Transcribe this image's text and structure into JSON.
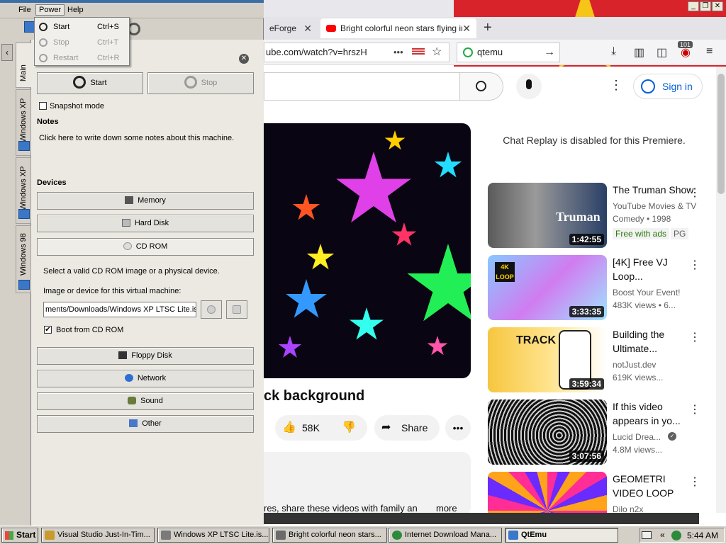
{
  "browser": {
    "window_controls": {
      "minimize": "_",
      "maximize": "❐",
      "close": "✕"
    },
    "tabs": [
      {
        "label": "eForge",
        "close": "✕"
      },
      {
        "label": "Bright colorful neon stars flying in",
        "close": "✕"
      }
    ],
    "new_tab": "+",
    "url_text": "ube.com/watch?v=hrszH",
    "url_more": "•••",
    "search_value": "qtemu",
    "search_go": "→",
    "badge_count": "101",
    "nav_icons": [
      "download-icon",
      "library-icon",
      "reader-icon",
      "extension-icon",
      "hamburger-icon"
    ]
  },
  "youtube": {
    "sign_in": "Sign in",
    "kebab": "⋮",
    "video_title": "ck background",
    "likes": "58K",
    "share": "Share",
    "more_actions": "•••",
    "chat_replay": "Chat Replay is disabled for this Premiere.",
    "description": "res, share these videos with family an",
    "description_more": "more",
    "recommendations": [
      {
        "title": "The Truman Show",
        "channel": "YouTube Movies & TV",
        "meta": "Comedy • 1998",
        "tags": [
          "Free with ads",
          "PG"
        ],
        "duration": "1:42:55",
        "thumb_text": "Truman"
      },
      {
        "title": "[4K] Free VJ Loop...",
        "channel": "Boost Your Event!",
        "meta": "483K views • 6...",
        "tags": [],
        "duration": "3:33:35",
        "thumb_text": "4K LOOP"
      },
      {
        "title": "Building the Ultimate...",
        "channel": "notJust.dev",
        "meta": "619K views...",
        "tags": [],
        "duration": "3:59:34",
        "thumb_text": "TRACK"
      },
      {
        "title": "If this video appears in yo...",
        "channel": "Lucid Drea...",
        "meta": "4.8M views...",
        "tags": [],
        "duration": "3:07:56",
        "thumb_text": ""
      },
      {
        "title": "GEOMETRI VIDEO LOOP",
        "channel": "Dilo n2x",
        "meta": "",
        "tags": [],
        "duration": "",
        "thumb_text": ""
      }
    ]
  },
  "qtemu": {
    "menu": {
      "file": "File",
      "power": "Power",
      "help": "Help"
    },
    "power_menu": [
      {
        "label": "Start",
        "shortcut": "Ctrl+S",
        "enabled": true
      },
      {
        "label": "Stop",
        "shortcut": "Ctrl+T",
        "enabled": false
      },
      {
        "label": "Restart",
        "shortcut": "Ctrl+R",
        "enabled": false
      }
    ],
    "vertical_tabs": [
      "Main",
      "Windows XP",
      "Windows XP",
      "Windows 98"
    ],
    "start": "Start",
    "stop": "Stop",
    "snapshot_mode": "Snapshot mode",
    "notes_heading": "Notes",
    "notes_text": "Click here to write down some notes about this machine.",
    "devices_heading": "Devices",
    "devices": {
      "memory": "Memory",
      "hard_disk": "Hard Disk",
      "cd_rom": "CD ROM",
      "floppy": "Floppy Disk",
      "network": "Network",
      "sound": "Sound",
      "other": "Other"
    },
    "cdrom_hint": "Select a valid CD ROM image or a physical device.",
    "image_label": "Image or device for this virtual machine:",
    "image_path": "ments/Downloads/Windows XP LTSC Lite.iso",
    "boot_from_cd": "Boot from CD ROM",
    "boot_checked": "✔"
  },
  "taskbar": {
    "start": "Start",
    "tasks": [
      {
        "label": "Visual Studio Just-In-Tim...",
        "icon": "vs-icon",
        "active": false
      },
      {
        "label": "Windows XP LTSC Lite.is...",
        "icon": "disc-icon",
        "active": false
      },
      {
        "label": "Bright colorful neon stars...",
        "icon": "browser-icon",
        "active": false
      },
      {
        "label": "Internet Download Mana...",
        "icon": "idm-icon",
        "active": false
      },
      {
        "label": "QtEmu",
        "icon": "qtemu-icon",
        "active": true
      }
    ],
    "tray_arrows": "«",
    "clock": "5:44 AM"
  }
}
